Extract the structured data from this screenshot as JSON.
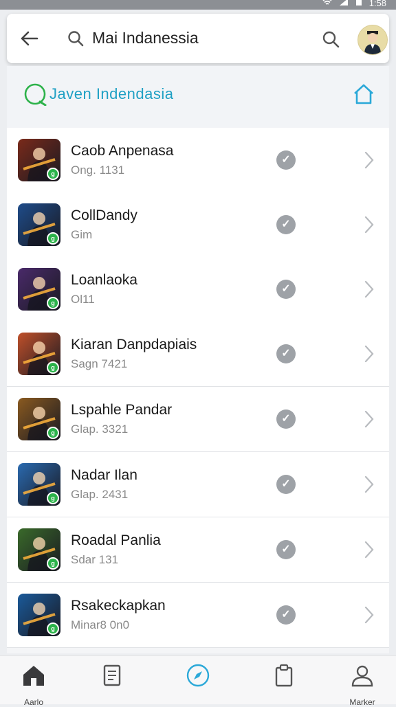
{
  "status_bar": {
    "time": "1:58"
  },
  "search": {
    "query": "Mai Indanessia"
  },
  "header": {
    "brand": "Javen Indendasia"
  },
  "apps": [
    {
      "title": "Caob Anpenasa",
      "subtitle": "Ong. 1131",
      "icon_color": "#7a2a1a"
    },
    {
      "title": "CollDandy",
      "subtitle": "Gim",
      "icon_color": "#1e4c8a"
    },
    {
      "title": "Loanlaoka",
      "subtitle": "Ol11",
      "icon_color": "#4a2a6a"
    },
    {
      "title": "Kiaran Danpdapiais",
      "subtitle": "Sagn 7421",
      "icon_color": "#c0502a"
    },
    {
      "title": "Lspahle Pandar",
      "subtitle": "Glap. 3321",
      "icon_color": "#8a5a20"
    },
    {
      "title": "Nadar Ilan",
      "subtitle": "Glap. 2431",
      "icon_color": "#2a6ab0"
    },
    {
      "title": "Roadal Panlia",
      "subtitle": "Sdar 131",
      "icon_color": "#3a6a2a"
    },
    {
      "title": "Rsakeckapkan",
      "subtitle": "Minar8 0n0",
      "icon_color": "#1a5a9a"
    }
  ],
  "tabbar": {
    "tabs": [
      {
        "label": "Aarlo",
        "icon": "home-icon"
      },
      {
        "label": "",
        "icon": "document-icon"
      },
      {
        "label": "",
        "icon": "compass-icon"
      },
      {
        "label": "",
        "icon": "clipboard-icon"
      },
      {
        "label": "Marker",
        "icon": "person-icon"
      }
    ],
    "active_color": "#2aa8d8"
  }
}
